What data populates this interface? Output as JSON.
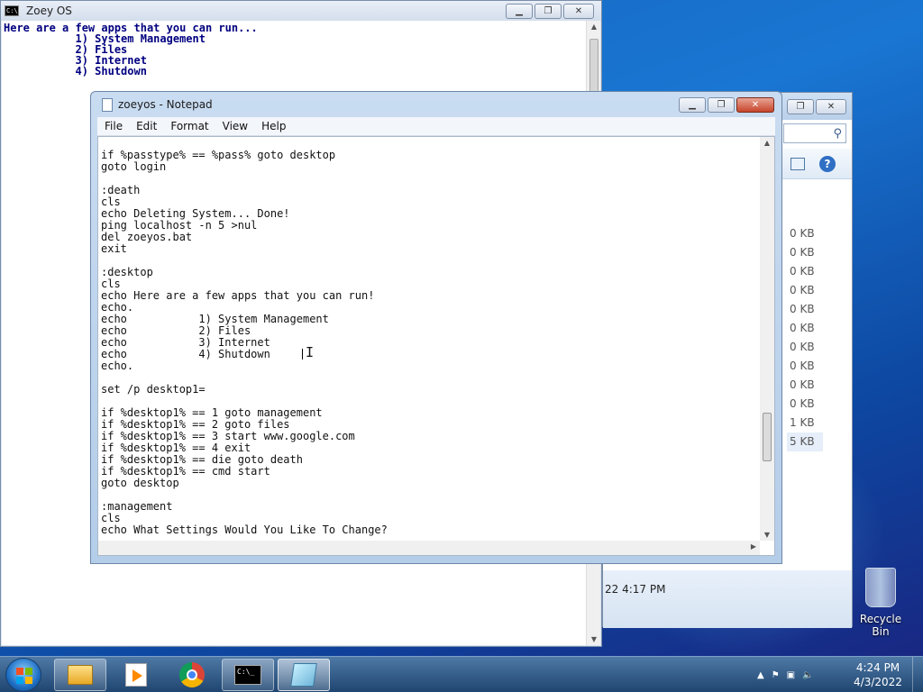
{
  "console": {
    "title": "Zoey OS",
    "output_lines": [
      "Here are a few apps that you can run...",
      "",
      "           1) System Management",
      "           2) Files",
      "           3) Internet",
      "           4) Shutdown"
    ]
  },
  "explorer": {
    "size_cells": [
      "0 KB",
      "0 KB",
      "0 KB",
      "0 KB",
      "0 KB",
      "0 KB",
      "0 KB",
      "0 KB",
      "0 KB",
      "0 KB",
      "1 KB",
      "5 KB"
    ],
    "status_text": "22 4:17 PM"
  },
  "notepad": {
    "title": "zoeyos - Notepad",
    "menu": [
      "File",
      "Edit",
      "Format",
      "View",
      "Help"
    ],
    "content_lines": [
      "if %passtype% == %pass% goto desktop",
      "goto login",
      "",
      ":death",
      "cls",
      "echo Deleting System... Done!",
      "ping localhost -n 5 >nul",
      "del zoeyos.bat",
      "exit",
      "",
      ":desktop",
      "cls",
      "echo Here are a few apps that you can run!",
      "echo.",
      "echo           1) System Management",
      "echo           2) Files",
      "echo           3) Internet",
      "echo           4) Shutdown",
      "echo.",
      "",
      "set /p desktop1=",
      "",
      "if %desktop1% == 1 goto management",
      "if %desktop1% == 2 goto files",
      "if %desktop1% == 3 start www.google.com",
      "if %desktop1% == 4 exit",
      "if %desktop1% == die goto death",
      "if %desktop1% == cmd start",
      "goto desktop",
      "",
      ":management",
      "cls",
      "echo What Settings Would You Like To Change?"
    ]
  },
  "desktop": {
    "recycle_bin_label": "Recycle Bin"
  },
  "taskbar": {
    "time": "4:24 PM",
    "date": "4/3/2022"
  }
}
